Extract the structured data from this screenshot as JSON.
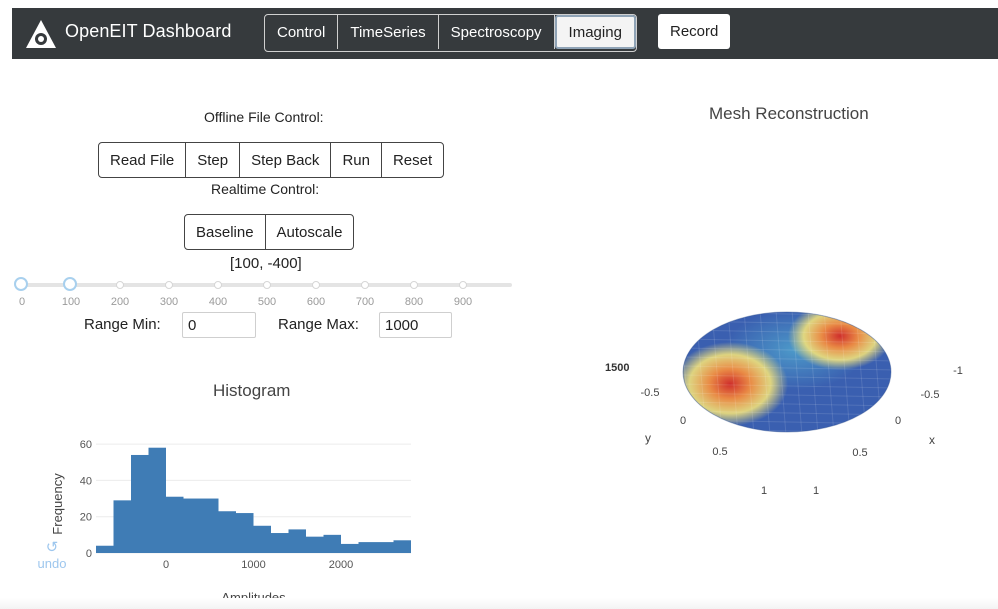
{
  "app": {
    "title": "OpenEIT Dashboard",
    "logo_icon": "triangle-eye-icon"
  },
  "nav": {
    "tabs": [
      {
        "label": "Control",
        "active": false
      },
      {
        "label": "TimeSeries",
        "active": false
      },
      {
        "label": "Spectroscopy",
        "active": false
      },
      {
        "label": "Imaging",
        "active": true
      }
    ],
    "record_label": "Record"
  },
  "offline": {
    "title": "Offline File Control:",
    "buttons": [
      "Read File",
      "Step",
      "Step Back",
      "Run",
      "Reset"
    ]
  },
  "realtime": {
    "title": "Realtime Control:",
    "buttons": [
      "Baseline",
      "Autoscale"
    ],
    "range_display": "[100, -400]"
  },
  "slider": {
    "ticks": [
      "0",
      "100",
      "200",
      "300",
      "400",
      "500",
      "600",
      "700",
      "800",
      "900"
    ],
    "handle_values": [
      0,
      100
    ],
    "max": 1000
  },
  "range": {
    "min_label": "Range Min:",
    "min_value": "0",
    "max_label": "Range Max:",
    "max_value": "1000"
  },
  "colors": {
    "navbar": "#363a3d",
    "bar": "#3f7cb5",
    "accent": "#9ec7ee"
  },
  "histogram": {
    "title": "Histogram",
    "xlabel": "Amplitudes",
    "ylabel": "Frequency",
    "undo_label": "undo",
    "undo_icon": "undo-icon"
  },
  "chart_data": {
    "type": "bar",
    "title": "Histogram",
    "xlabel": "Amplitudes",
    "ylabel": "Frequency",
    "bin_width": 200,
    "bin_starts": [
      -800,
      -600,
      -400,
      -200,
      0,
      200,
      400,
      600,
      800,
      1000,
      1200,
      1400,
      1600,
      1800,
      2000,
      2200,
      2400,
      2600
    ],
    "values": [
      4,
      29,
      54,
      58,
      31,
      30,
      30,
      23,
      22,
      15,
      11,
      13,
      9,
      10,
      5,
      6,
      6,
      7
    ],
    "xlim": [
      -800,
      2800
    ],
    "ylim": [
      0,
      65
    ],
    "xticks": [
      "0",
      "1000",
      "2000"
    ],
    "yticks": [
      "0",
      "20",
      "40",
      "60"
    ],
    "grid": true
  },
  "mesh": {
    "title": "Mesh Reconstruction",
    "colorbar_text": "1500",
    "axis_x_label": "x",
    "axis_y_label": "y",
    "left_ticks": [
      "-0.5",
      "0",
      "0.5",
      "1"
    ],
    "right_ticks": [
      "-1",
      "-0.5",
      "0",
      "0.5",
      "1"
    ],
    "colorscale": [
      "#3a5fb0",
      "#4fa0cc",
      "#f0e07a",
      "#e98a45",
      "#cf2f2c"
    ]
  }
}
